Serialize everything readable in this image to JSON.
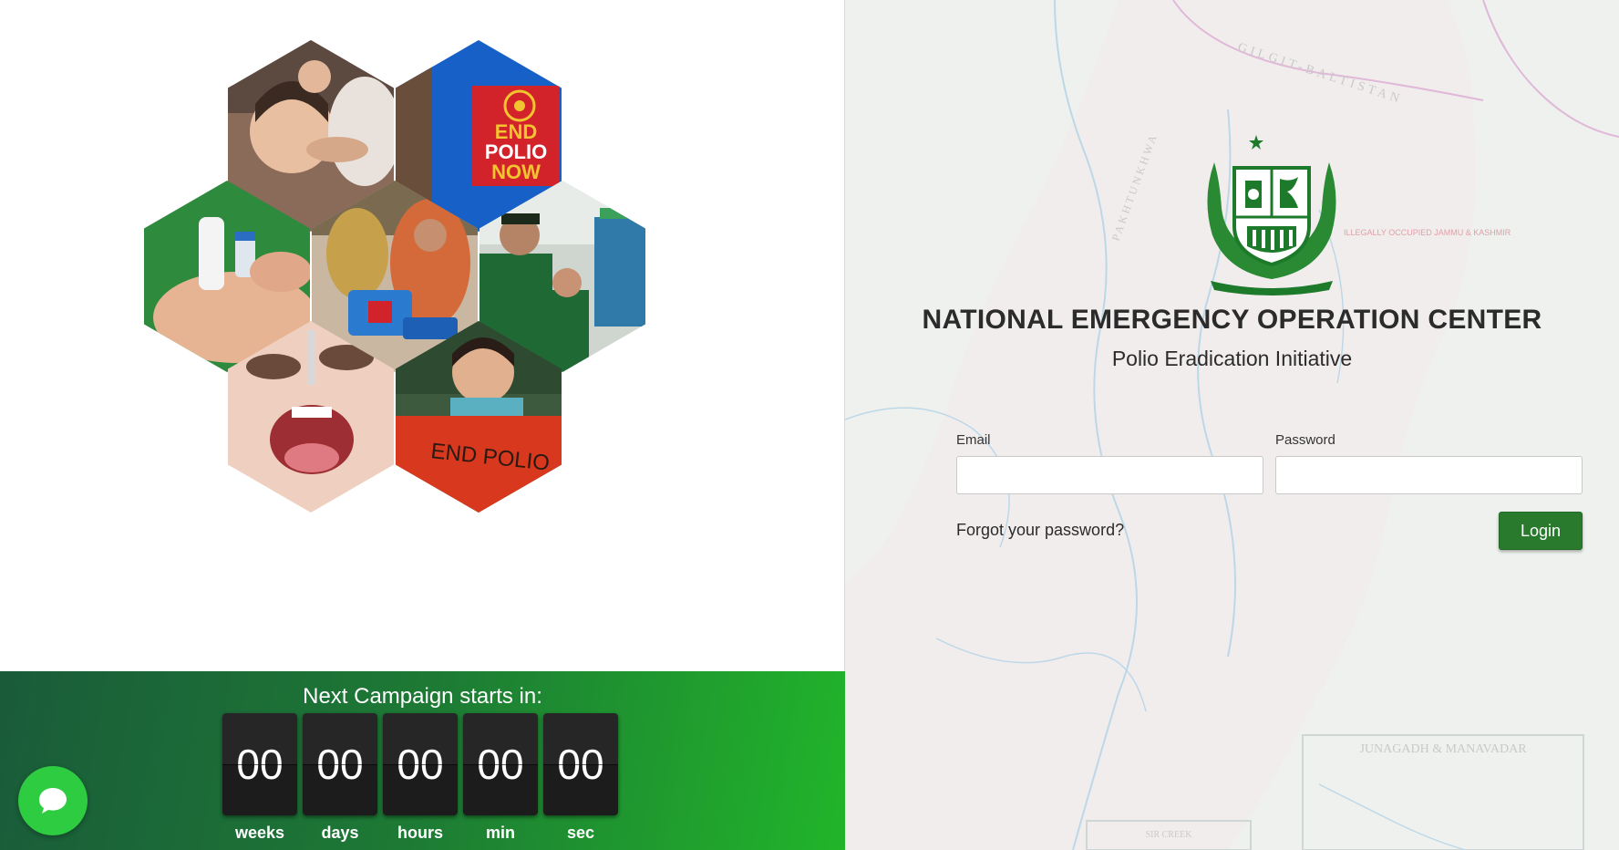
{
  "org": {
    "title": "NATIONAL EMERGENCY OPERATION CENTER",
    "subtitle": "Polio Eradication Initiative"
  },
  "login_form": {
    "email_label": "Email",
    "email_value": "",
    "password_label": "Password",
    "password_value": "",
    "forgot_link": "Forgot your password?",
    "login_button": "Login"
  },
  "collage": {
    "photo_1_text": "END POLIO NOW",
    "photo_2_text": "END POLIO"
  },
  "countdown": {
    "title": "Next Campaign starts in:",
    "units": [
      {
        "value": "00",
        "label": "weeks"
      },
      {
        "value": "00",
        "label": "days"
      },
      {
        "value": "00",
        "label": "hours"
      },
      {
        "value": "00",
        "label": "min"
      },
      {
        "value": "00",
        "label": "sec"
      }
    ]
  },
  "map_labels": {
    "region_1": "GILGIT-BALTISTAN",
    "region_2": "PAKHTUNKHWA",
    "region_3": "JUNAGADH & MANAVADAR",
    "region_4": "SIR CREEK",
    "note": "ILLEGALLY OCCUPIED JAMMU & KASHMIR"
  },
  "colors": {
    "brand_green": "#2a7a2e",
    "countdown_gradient_start": "#1a5b3a",
    "countdown_gradient_end": "#21b52a",
    "chat_green": "#2ecc40"
  },
  "icons": {
    "chat": "chat-bubble-icon",
    "emblem": "pakistan-emblem-icon"
  }
}
